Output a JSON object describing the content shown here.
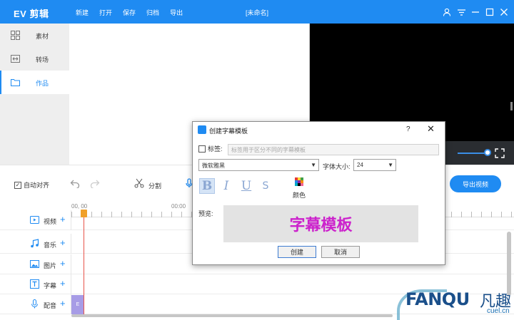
{
  "app": {
    "title": "EV 剪辑",
    "doc_title": "[未命名]"
  },
  "menu": [
    "新建",
    "打开",
    "保存",
    "归档",
    "导出"
  ],
  "window_controls": [
    "user-icon",
    "dropdown-icon",
    "minimize-icon",
    "maximize-icon",
    "close-icon"
  ],
  "sidebar": {
    "items": [
      {
        "label": "素材",
        "icon": "media-icon"
      },
      {
        "label": "转场",
        "icon": "transition-icon"
      },
      {
        "label": "作品",
        "icon": "folder-icon",
        "active": true
      }
    ]
  },
  "toolbar": {
    "auto_align": "自动对齐",
    "auto_align_checked": true,
    "split": "分割",
    "export": "导出视频"
  },
  "timeline": {
    "ruler": [
      "00, 00",
      "00:00"
    ],
    "tracks": [
      {
        "label": "视频",
        "icon": "video-icon"
      },
      {
        "label": "音乐",
        "icon": "music-icon"
      },
      {
        "label": "图片",
        "icon": "image-icon"
      },
      {
        "label": "字幕",
        "icon": "text-icon"
      },
      {
        "label": "配音",
        "icon": "microphone-icon"
      }
    ],
    "clip_label": "E"
  },
  "dialog": {
    "title": "创建字幕模板",
    "help": "?",
    "close": "✕",
    "tag_label": "标签:",
    "tag_placeholder": "标签用于区分不同的字幕模板",
    "font": "微软雅黑",
    "size_label": "字体大小:",
    "size": "24",
    "style_buttons": [
      "B",
      "I",
      "U",
      "S"
    ],
    "color_label": "颜色",
    "preview_label": "预览:",
    "preview_text": "字幕模板",
    "preview_color": "#cc22cc",
    "create": "创建",
    "cancel": "取消"
  },
  "watermark": {
    "brand": "FANQU",
    "cn": "凡趣",
    "url": "cuel.cn"
  },
  "colors": {
    "accent": "#1f8bf2",
    "playhead": "#e8534a"
  }
}
